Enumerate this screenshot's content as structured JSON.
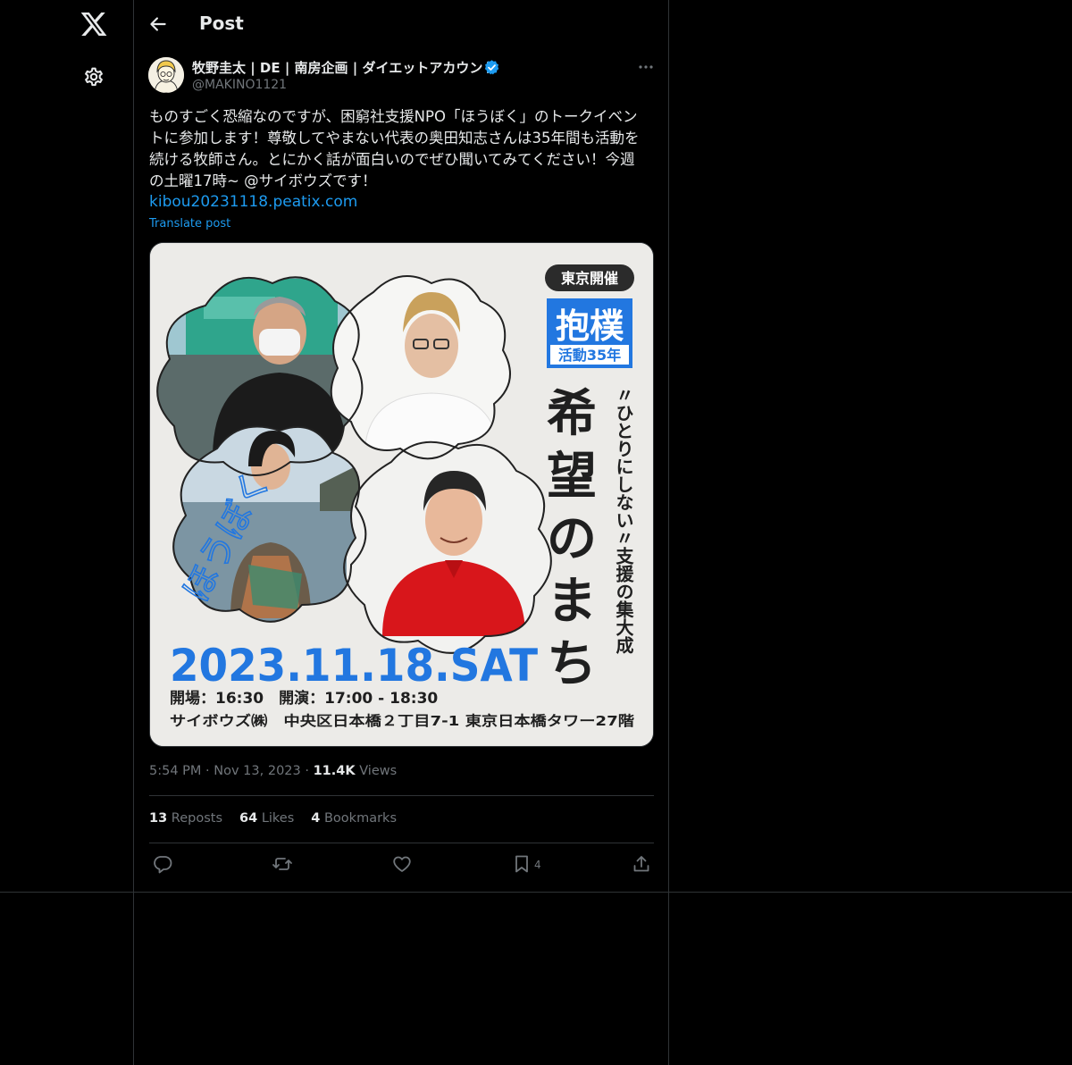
{
  "nav": {
    "logo_icon": "x-logo-icon",
    "settings_icon": "gear-icon"
  },
  "header": {
    "back_icon": "arrow-left-icon",
    "title": "Post"
  },
  "post": {
    "author": {
      "display_name": "牧野圭太 | DE | 南房企画 | ダイエットアカウント",
      "handle": "@MAKINO1121",
      "verified": true
    },
    "text_lines": [
      "ものすごく恐縮なのですが、困窮社支援NPO「ほうぼく」のトークイベン",
      "トに参加します！尊敬してやまない代表の奥田知志さんは35年間も活動を",
      "続ける牧師さん。とにかく話が面白いのでぜひ聞いてみてください！今週",
      "の土曜17時~ @サイボウズです！"
    ],
    "link": "kibou20231118.peatix.com",
    "translate_label": "Translate post",
    "image": {
      "badge": "東京開催",
      "org_title": "抱樸",
      "org_subtitle": "活動35年",
      "title_chars": [
        "希",
        "望",
        "の",
        "ま",
        "ち"
      ],
      "tagline": "〃ひとりにしない〃支援の集大成",
      "date": "2023.11.18.SAT",
      "time_line": "開場：16:30　開演：17:00 - 18:30",
      "venue_line": "サイボウズ㈱　中央区日本橋２丁目7-1 東京日本橋タワー27階",
      "handwriting": "ほうぼく"
    },
    "time": "5:54 PM",
    "date": "Nov 13, 2023",
    "views_count": "11.4K",
    "views_label": "Views",
    "separator": "·",
    "reposts_count": "13",
    "reposts_label": "Reposts",
    "likes_count": "64",
    "likes_label": "Likes",
    "bookmarks_count": "4",
    "bookmarks_label": "Bookmarks",
    "actions": {
      "reply_icon": "reply-icon",
      "repost_icon": "repost-icon",
      "like_icon": "heart-icon",
      "bookmark_icon": "bookmark-icon",
      "bookmark_count": "4",
      "share_icon": "share-icon"
    }
  },
  "colors": {
    "background": "#000000",
    "text_primary": "#e7e9ea",
    "text_secondary": "#71767b",
    "accent": "#1d9bf0",
    "border": "#2f3336",
    "poster_blue": "#2277e0",
    "poster_bg": "#ecebe8"
  }
}
